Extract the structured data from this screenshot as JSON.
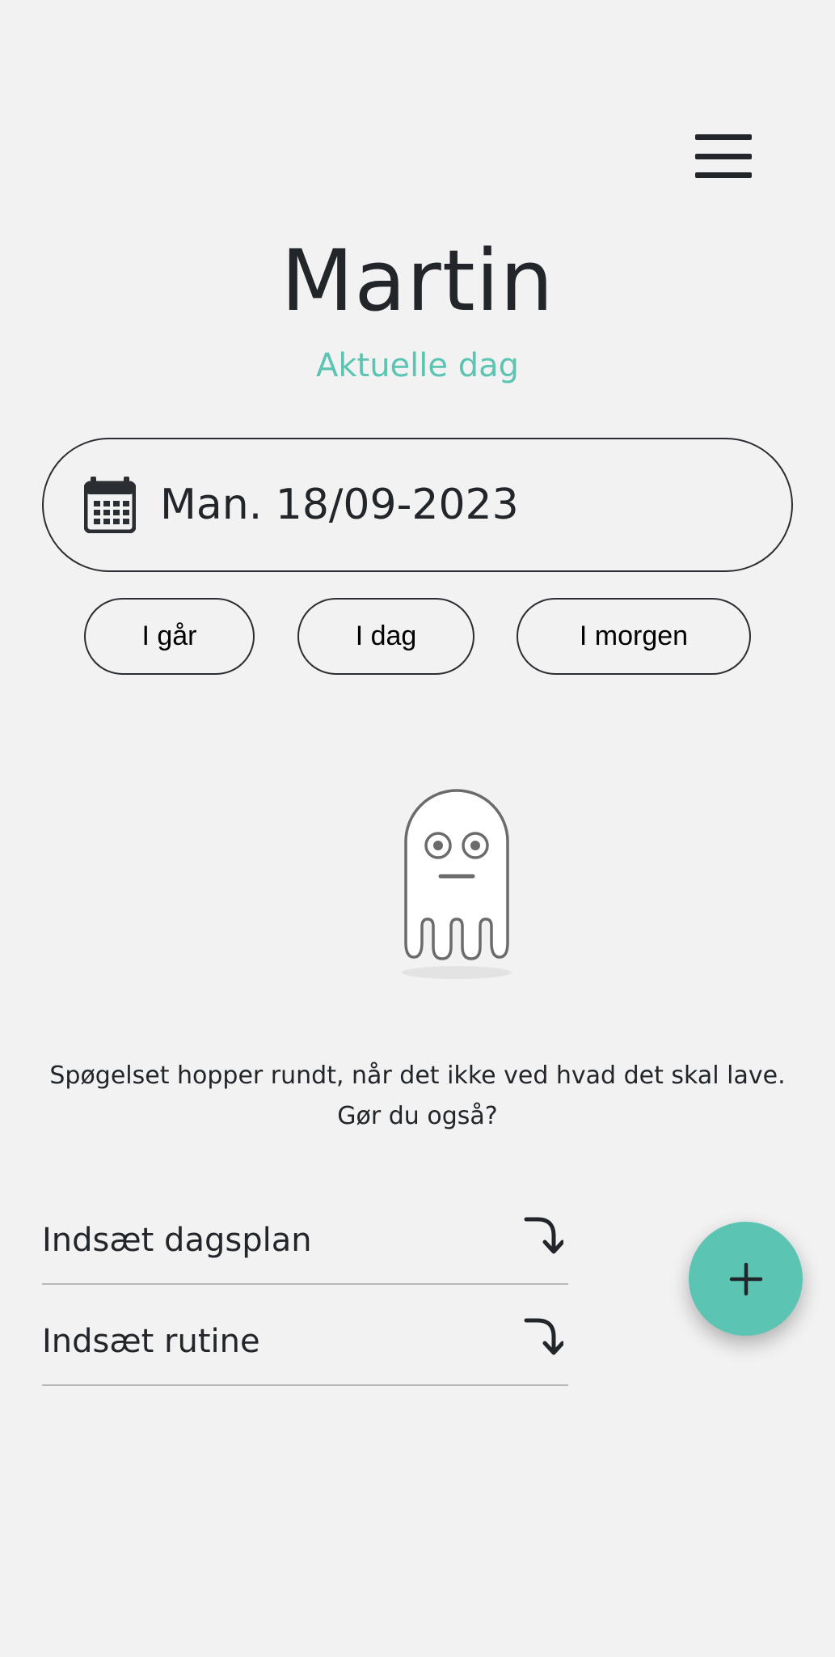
{
  "header": {
    "menu_icon": "hamburger-menu-icon",
    "title": "Martin",
    "subtitle": "Aktuelle dag"
  },
  "date_picker": {
    "icon": "calendar-icon",
    "value": "Man. 18/09-2023"
  },
  "day_buttons": {
    "yesterday": "I går",
    "today": "I dag",
    "tomorrow": "I morgen"
  },
  "empty_state": {
    "illustration": "ghost-illustration",
    "message": "Spøgelset hopper rundt, når det ikke ved hvad det skal lave. Gør du også?"
  },
  "actions": [
    {
      "label": "Indsæt dagsplan",
      "icon": "arrow-turn-down-right-icon"
    },
    {
      "label": "Indsæt rutine",
      "icon": "arrow-turn-down-right-icon"
    }
  ],
  "fab": {
    "icon": "plus-icon"
  },
  "colors": {
    "background": "#f2f2f2",
    "accent": "#5bc4b3",
    "text": "#22262b"
  }
}
